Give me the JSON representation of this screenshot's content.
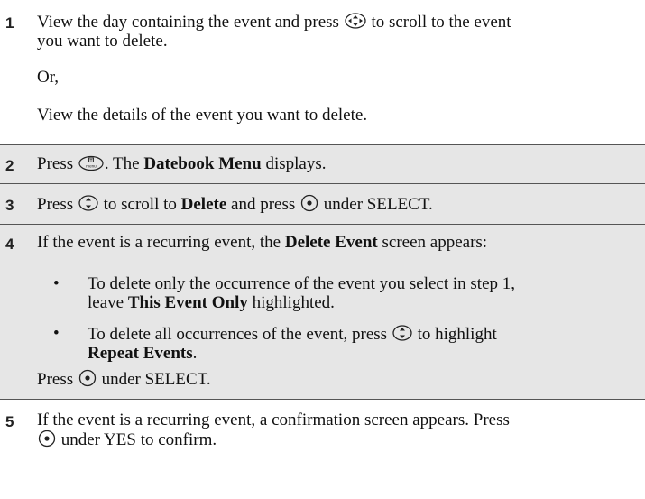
{
  "steps": [
    {
      "number": "1",
      "line1": "View the day containing the event and press",
      "line1_end": "to scroll to the event",
      "line2": "you want to delete.",
      "or": "Or,",
      "alt": "View the details of the event you want to delete."
    },
    {
      "number": "2",
      "pre": "Press",
      "post": ". The",
      "bold": "Datebook Menu",
      "tail": "displays."
    },
    {
      "number": "3",
      "pre": "Press",
      "mid": "to scroll to",
      "bold": "Delete",
      "mid2": "and press",
      "tail": "under SELECT."
    },
    {
      "number": "4",
      "pre": "If the event is a recurring event, the",
      "bold": "Delete Event",
      "tail": "screen appears:",
      "bullet_char": "•",
      "bullets": [
        {
          "line1": "To delete only the occurrence of the event you select in step 1,",
          "line2_pre": "leave",
          "line2_bold": "This Event Only",
          "line2_tail": "highlighted."
        },
        {
          "line1_pre": "To delete all occurrences of the event, press",
          "line1_tail": "to highlight",
          "line2_bold": "Repeat Events",
          "line2_tail": "."
        }
      ],
      "final_pre": "Press",
      "final_tail": "under SELECT."
    },
    {
      "number": "5",
      "line1": "If the event is a recurring event, a confirmation screen appears. Press",
      "line2_tail": "under YES to confirm."
    }
  ],
  "icons": {
    "nav_4way": "4-way-navigation-key-icon",
    "nav_updown": "up-down-navigation-key-icon",
    "menu_key": "menu-key-icon",
    "select_key": "softkey-center-dot-icon"
  }
}
